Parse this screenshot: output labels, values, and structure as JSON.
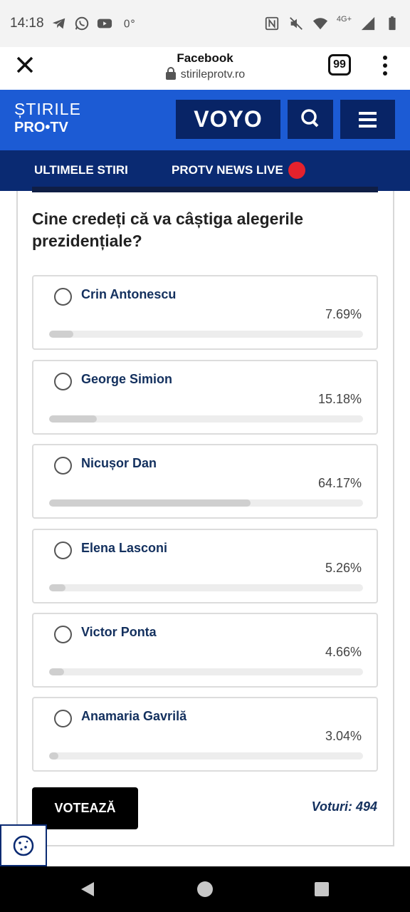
{
  "status_bar": {
    "time": "14:18",
    "network": "4G+",
    "left_icons": [
      "telegram-icon",
      "whatsapp-icon",
      "youtube-icon",
      "degree-icon"
    ],
    "right_icons": [
      "nfc-icon",
      "mute-icon",
      "wifi-icon",
      "signal-icon",
      "battery-icon"
    ]
  },
  "browser": {
    "title": "Facebook",
    "url": "stirileprotv.ro",
    "tabs_count": "99"
  },
  "site_header": {
    "logo_top": "ȘTIRILE",
    "logo_bottom": "PRO•TV",
    "voyo_label": "VOYO",
    "brand_color": "#1c5bd4",
    "dark_color": "#082466"
  },
  "nav": {
    "items": [
      {
        "label": "ULTIMELE STIRI"
      },
      {
        "label": "PROTV NEWS LIVE"
      }
    ],
    "live_color": "#e4222d"
  },
  "poll": {
    "question": "Cine credeți că va câștiga alegerile prezidențiale?",
    "options": [
      {
        "name": "Crin Antonescu",
        "percent_label": "7.69%",
        "percent": 7.69
      },
      {
        "name": "George Simion",
        "percent_label": "15.18%",
        "percent": 15.18
      },
      {
        "name": "Nicușor Dan",
        "percent_label": "64.17%",
        "percent": 64.17
      },
      {
        "name": "Elena Lasconi",
        "percent_label": "5.26%",
        "percent": 5.26
      },
      {
        "name": "Victor Ponta",
        "percent_label": "4.66%",
        "percent": 4.66
      },
      {
        "name": "Anamaria Gavrilă",
        "percent_label": "3.04%",
        "percent": 3.04
      }
    ],
    "vote_button": "VOTEAZĂ",
    "votes_label": "Voturi: 494"
  },
  "cookie": {
    "icon": "cookie-icon"
  },
  "system_nav": {
    "icons": [
      "back-icon",
      "home-icon",
      "recents-icon"
    ]
  }
}
